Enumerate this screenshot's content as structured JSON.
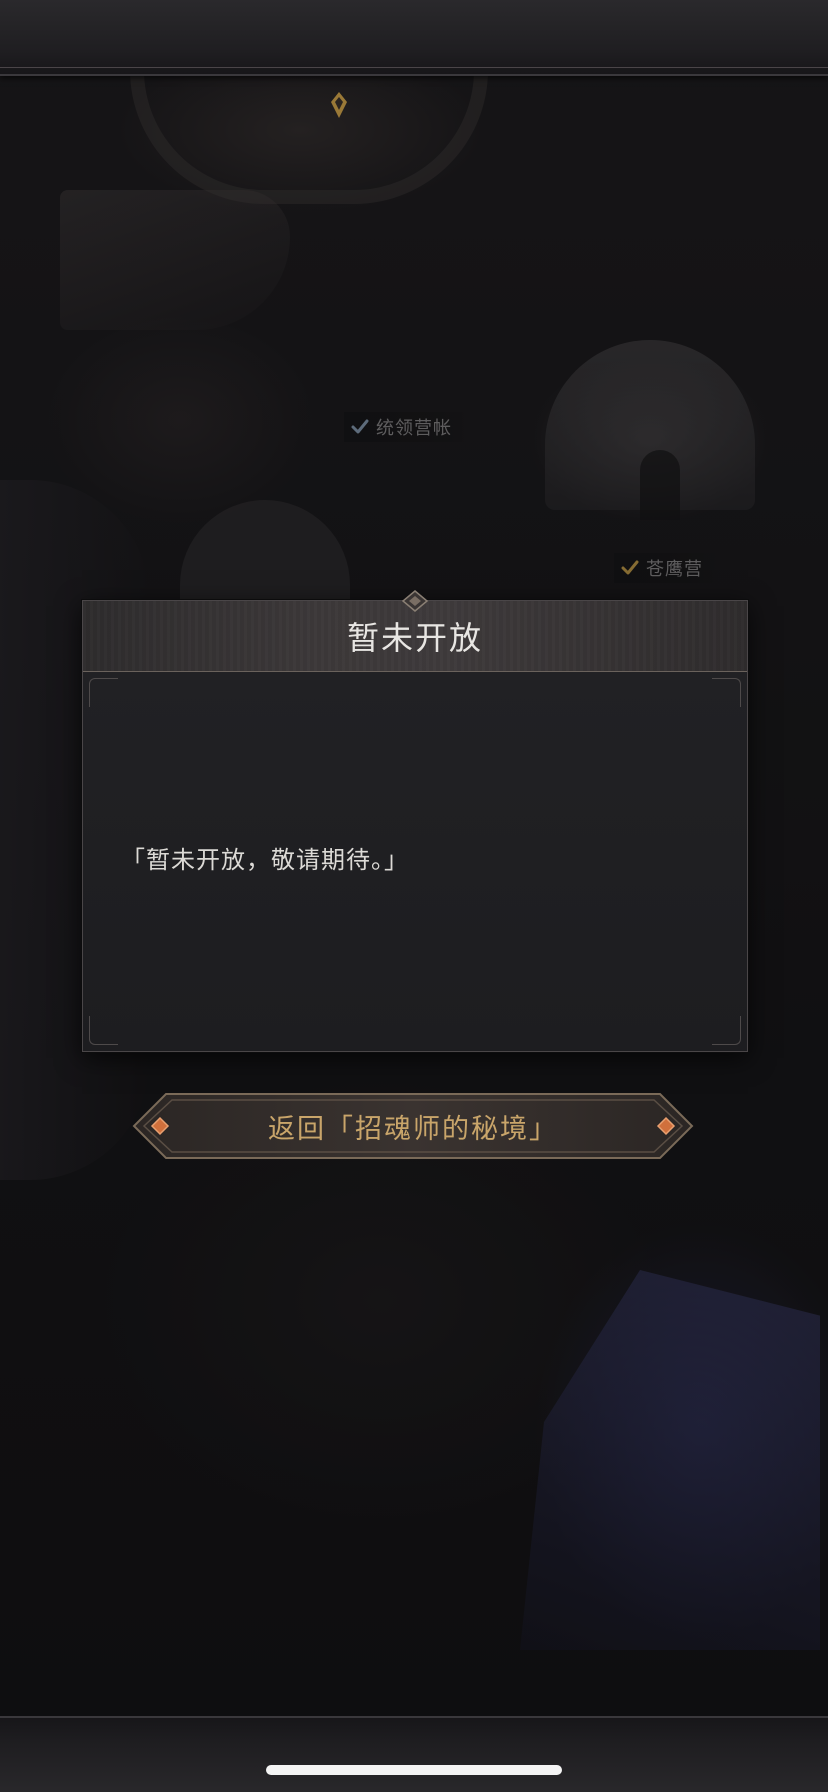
{
  "map": {
    "markers": [
      {
        "label": "统领营帐",
        "icon": "check-icon"
      },
      {
        "label": "苍鹰营",
        "icon": "check-icon"
      }
    ]
  },
  "dialog": {
    "title": "暂未开放",
    "message": "「暂未开放，敬请期待。」"
  },
  "return_button": {
    "label": "返回「招魂师的秘境」"
  },
  "colors": {
    "accent_gold": "#c9a56a",
    "dialog_bg": "#1e1e21",
    "title_text": "#e8e6e3"
  }
}
